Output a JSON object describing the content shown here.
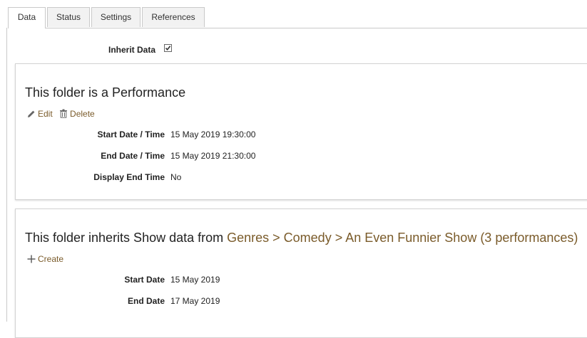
{
  "tabs": [
    {
      "label": "Data",
      "active": true
    },
    {
      "label": "Status",
      "active": false
    },
    {
      "label": "Settings",
      "active": false
    },
    {
      "label": "References",
      "active": false
    }
  ],
  "inherit": {
    "label": "Inherit Data",
    "checked": true
  },
  "performance_panel": {
    "title": "This folder is a Performance",
    "actions": {
      "edit": "Edit",
      "delete": "Delete"
    },
    "fields": [
      {
        "label": "Start Date / Time",
        "value": "15 May 2019 19:30:00"
      },
      {
        "label": "End Date / Time",
        "value": "15 May 2019 21:30:00"
      },
      {
        "label": "Display End Time",
        "value": "No"
      }
    ]
  },
  "show_panel": {
    "title_prefix": "This folder inherits Show data from ",
    "title_link": "Genres > Comedy > An Even Funnier Show (3 performances)",
    "actions": {
      "create": "Create"
    },
    "fields": [
      {
        "label": "Start Date",
        "value": "15 May 2019"
      },
      {
        "label": "End Date",
        "value": "17 May 2019"
      }
    ]
  },
  "colors": {
    "link": "#7a5b2a",
    "border": "#c9c9c9",
    "tab_bg": "#f2f2f2"
  }
}
